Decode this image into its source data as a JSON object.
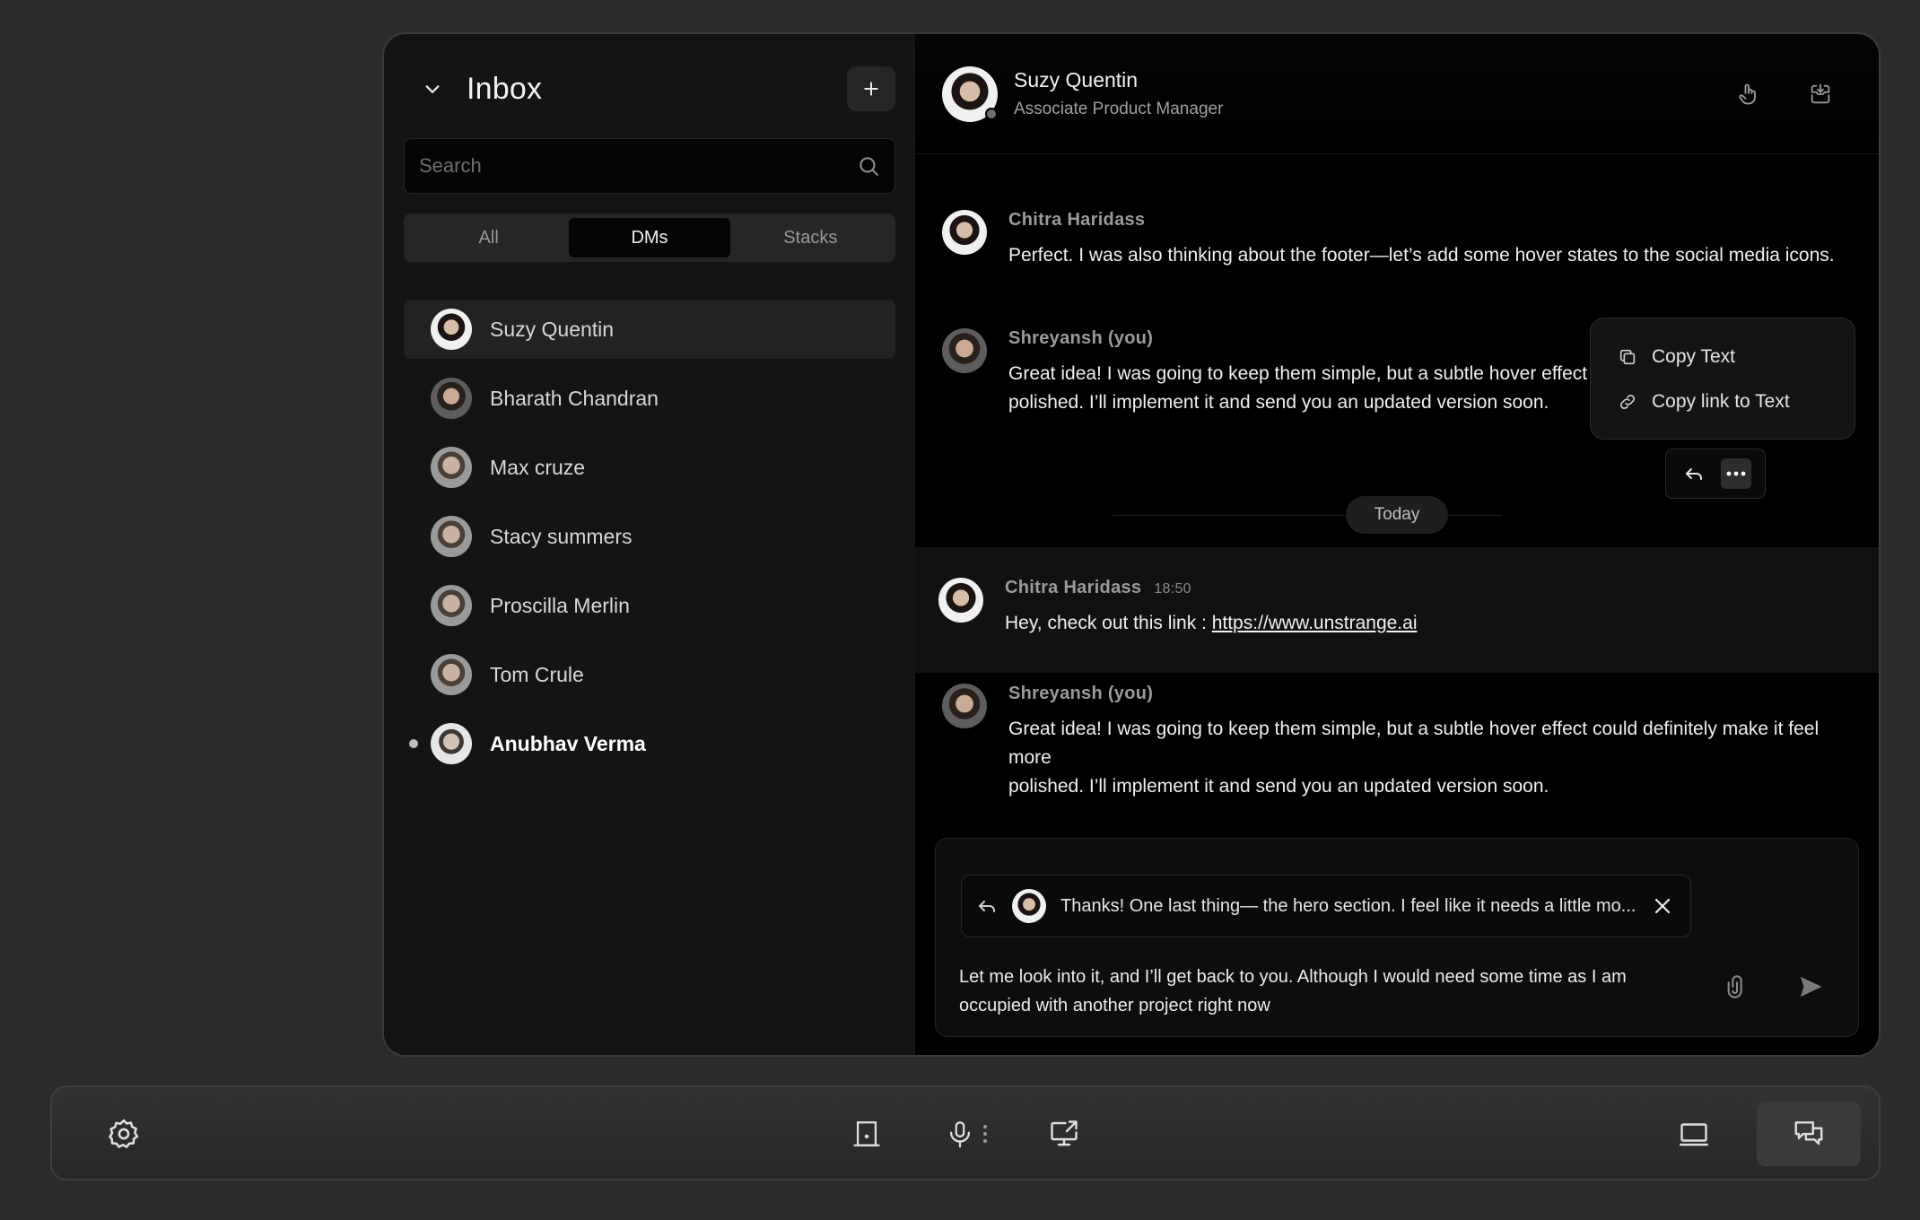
{
  "sidebar": {
    "title": "Inbox",
    "search_placeholder": "Search",
    "tabs": [
      {
        "label": "All",
        "active": false
      },
      {
        "label": "DMs",
        "active": true
      },
      {
        "label": "Stacks",
        "active": false
      }
    ],
    "contacts": [
      {
        "name": "Suzy Quentin",
        "selected": true,
        "unread": false
      },
      {
        "name": "Bharath Chandran",
        "selected": false,
        "unread": false
      },
      {
        "name": "Max cruze",
        "selected": false,
        "unread": false
      },
      {
        "name": "Stacy summers",
        "selected": false,
        "unread": false
      },
      {
        "name": "Proscilla Merlin",
        "selected": false,
        "unread": false
      },
      {
        "name": "Tom Crule",
        "selected": false,
        "unread": false
      },
      {
        "name": "Anubhav Verma",
        "selected": false,
        "unread": true
      }
    ]
  },
  "chat": {
    "header": {
      "name": "Suzy Quentin",
      "subtitle": "Associate Product Manager"
    },
    "messages": [
      {
        "author": "Chitra Haridass",
        "time": "",
        "text": "Perfect. I was also thinking about the footer—let’s add some hover states to the social media icons."
      },
      {
        "author": "Shreyansh (you)",
        "time": "",
        "text": "Great idea! I was going to keep them simple, but a subtle hover effect co",
        "text2": "polished. I’ll implement it and send you an updated version soon."
      },
      {
        "author": "Chitra Haridass",
        "time": "18:50",
        "text": "Hey, check out this link : ",
        "link": "https://www.unstrange.ai"
      },
      {
        "author": "Shreyansh (you)",
        "time": "",
        "text": "Great idea! I was going to keep them simple, but a subtle hover effect could definitely make it feel more",
        "text2": "polished. I’ll implement it and send you an updated version soon."
      }
    ],
    "divider_label": "Today",
    "context_menu": [
      {
        "label": "Copy Text",
        "icon": "copy-icon"
      },
      {
        "label": "Copy link to Text",
        "icon": "link-icon"
      }
    ],
    "composer": {
      "reply_preview": "Thanks! One last thing— the hero section. I feel like it needs a little mo...",
      "text_line1": "Let me look into it, and I’ll get back to you. Although I would need some time as I am",
      "text_line2": "occupied with another project right now"
    }
  },
  "colors": {
    "background": "#2b2b2b",
    "window": "#0a0a0a",
    "sidebar": "#141414",
    "accent_text": "#f2f2f2"
  }
}
